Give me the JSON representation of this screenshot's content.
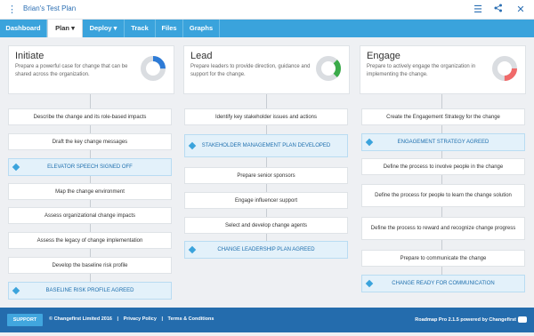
{
  "window": {
    "title": "Brian's Test Plan"
  },
  "nav": {
    "tabs": [
      {
        "label": "Dashboard",
        "active": false
      },
      {
        "label": "Plan ▾",
        "active": true
      },
      {
        "label": "Deploy ▾",
        "active": false
      },
      {
        "label": "Track",
        "active": false
      },
      {
        "label": "Files",
        "active": false
      },
      {
        "label": "Graphs",
        "active": false
      }
    ]
  },
  "phases": [
    {
      "title": "Initiate",
      "desc": "Prepare a powerful case for change that can be shared across the organization.",
      "progress": 0.25,
      "color": "#2e7bd6"
    },
    {
      "title": "Lead",
      "desc": "Prepare leaders to provide direction, guidance and support for the change.",
      "progress": 0.25,
      "color": "#3bab4a"
    },
    {
      "title": "Engage",
      "desc": "Prepare to actively engage the organization in implementing the change.",
      "progress": 0.25,
      "color": "#f06a6a"
    }
  ],
  "columns": [
    [
      {
        "kind": "task",
        "label": "Describe the change and its role-based impacts"
      },
      {
        "kind": "task",
        "label": "Draft the key change messages"
      },
      {
        "kind": "milestone",
        "label": "ELEVATOR SPEECH SIGNED OFF"
      },
      {
        "kind": "task",
        "label": "Map the change environment"
      },
      {
        "kind": "task",
        "label": "Assess organizational change impacts"
      },
      {
        "kind": "task",
        "label": "Assess the legacy of change implementation"
      },
      {
        "kind": "task",
        "label": "Develop the baseline risk profile"
      },
      {
        "kind": "milestone",
        "label": "BASELINE RISK PROFILE AGREED"
      }
    ],
    [
      {
        "kind": "task",
        "label": "Identify key stakeholder issues and actions"
      },
      {
        "kind": "milestone",
        "label": "STAKEHOLDER MANAGEMENT PLAN DEVELOPED"
      },
      {
        "kind": "task",
        "label": "Prepare senior sponsors"
      },
      {
        "kind": "task",
        "label": "Engage influencer support"
      },
      {
        "kind": "task",
        "label": "Select and develop change agents"
      },
      {
        "kind": "milestone",
        "label": "CHANGE LEADERSHIP PLAN AGREED"
      }
    ],
    [
      {
        "kind": "task",
        "label": "Create the Engagement Strategy for the change"
      },
      {
        "kind": "milestone",
        "label": "ENGAGEMENT STRATEGY AGREED"
      },
      {
        "kind": "task",
        "label": "Define the process to involve people in the change"
      },
      {
        "kind": "task",
        "label": "Define the process for people to learn the change solution"
      },
      {
        "kind": "task",
        "label": "Define the process to reward and recognize change progress"
      },
      {
        "kind": "task",
        "label": "Prepare to communicate the change"
      },
      {
        "kind": "milestone",
        "label": "CHANGE READY FOR COMMUNICATION"
      }
    ]
  ],
  "footer": {
    "support": "SUPPORT",
    "copyright": "© Changefirst Limited 2016",
    "privacy": "Privacy Policy",
    "terms": "Terms & Conditions",
    "version": "Roadmap Pro 2.1.5 powered by Changefirst"
  }
}
